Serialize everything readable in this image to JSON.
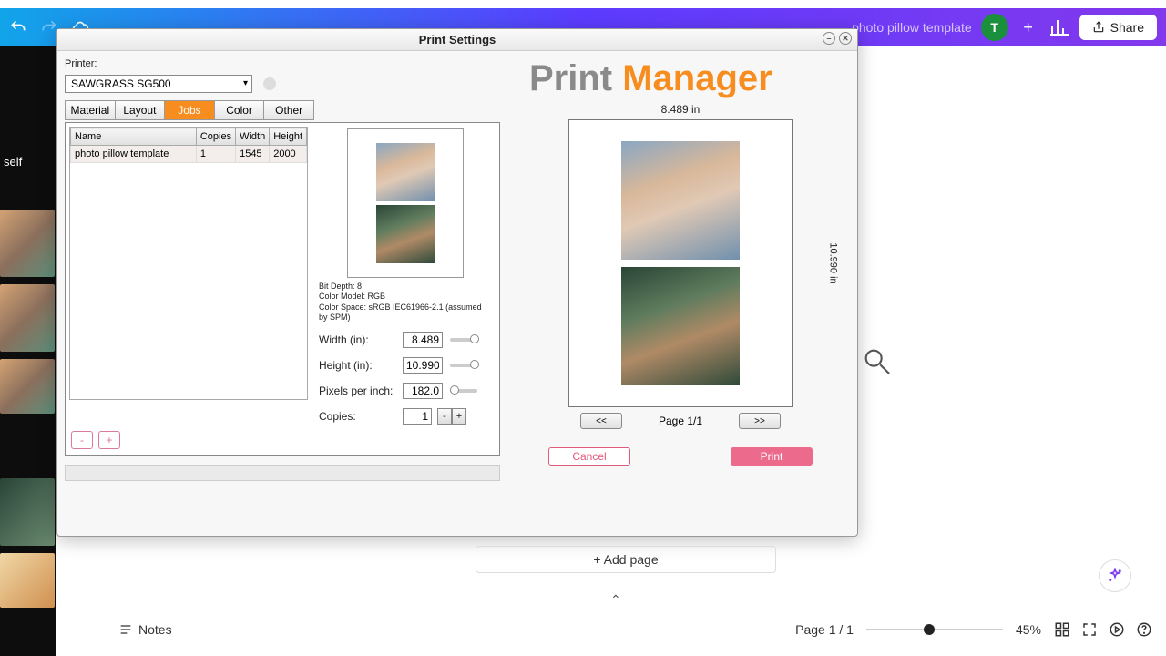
{
  "topbar": {
    "doc_title": "photo pillow template",
    "avatar_initial": "T",
    "share_label": "Share"
  },
  "sidebar": {
    "self_label": "self"
  },
  "dialog": {
    "title": "Print Settings",
    "printer_label": "Printer:",
    "printer_selected": "SAWGRASS SG500",
    "tabs": {
      "material": "Material",
      "layout": "Layout",
      "jobs": "Jobs",
      "color": "Color",
      "other": "Other"
    },
    "table": {
      "headers": {
        "name": "Name",
        "copies": "Copies",
        "width": "Width",
        "height": "Height"
      },
      "row": {
        "name": "photo pillow template",
        "copies": "1",
        "width": "1545",
        "height": "2000"
      }
    },
    "buttons": {
      "remove": "-",
      "add": "+"
    },
    "meta": {
      "bitdepth": "Bit Depth: 8",
      "colormodel": "Color Model: RGB",
      "colorspace": "Color Space: sRGB IEC61966-2.1 (assumed by SPM)"
    },
    "fields": {
      "width_label": "Width (in):",
      "width_val": "8.489",
      "height_label": "Height (in):",
      "height_val": "10.990",
      "ppi_label": "Pixels per inch:",
      "ppi_val": "182.0",
      "copies_label": "Copies:",
      "copies_val": "1"
    },
    "step": {
      "minus": "-",
      "plus": "+"
    },
    "brand_a": "Print ",
    "brand_b": "Manager",
    "dim_top": "8.489 in",
    "dim_side": "10.990 in",
    "pager": {
      "prev": "<<",
      "label": "Page 1/1",
      "next": ">>"
    },
    "actions": {
      "cancel": "Cancel",
      "print": "Print"
    }
  },
  "canvas": {
    "add_page": "+ Add page",
    "notes": "Notes",
    "page": "Page 1 / 1",
    "zoom": "45%"
  }
}
